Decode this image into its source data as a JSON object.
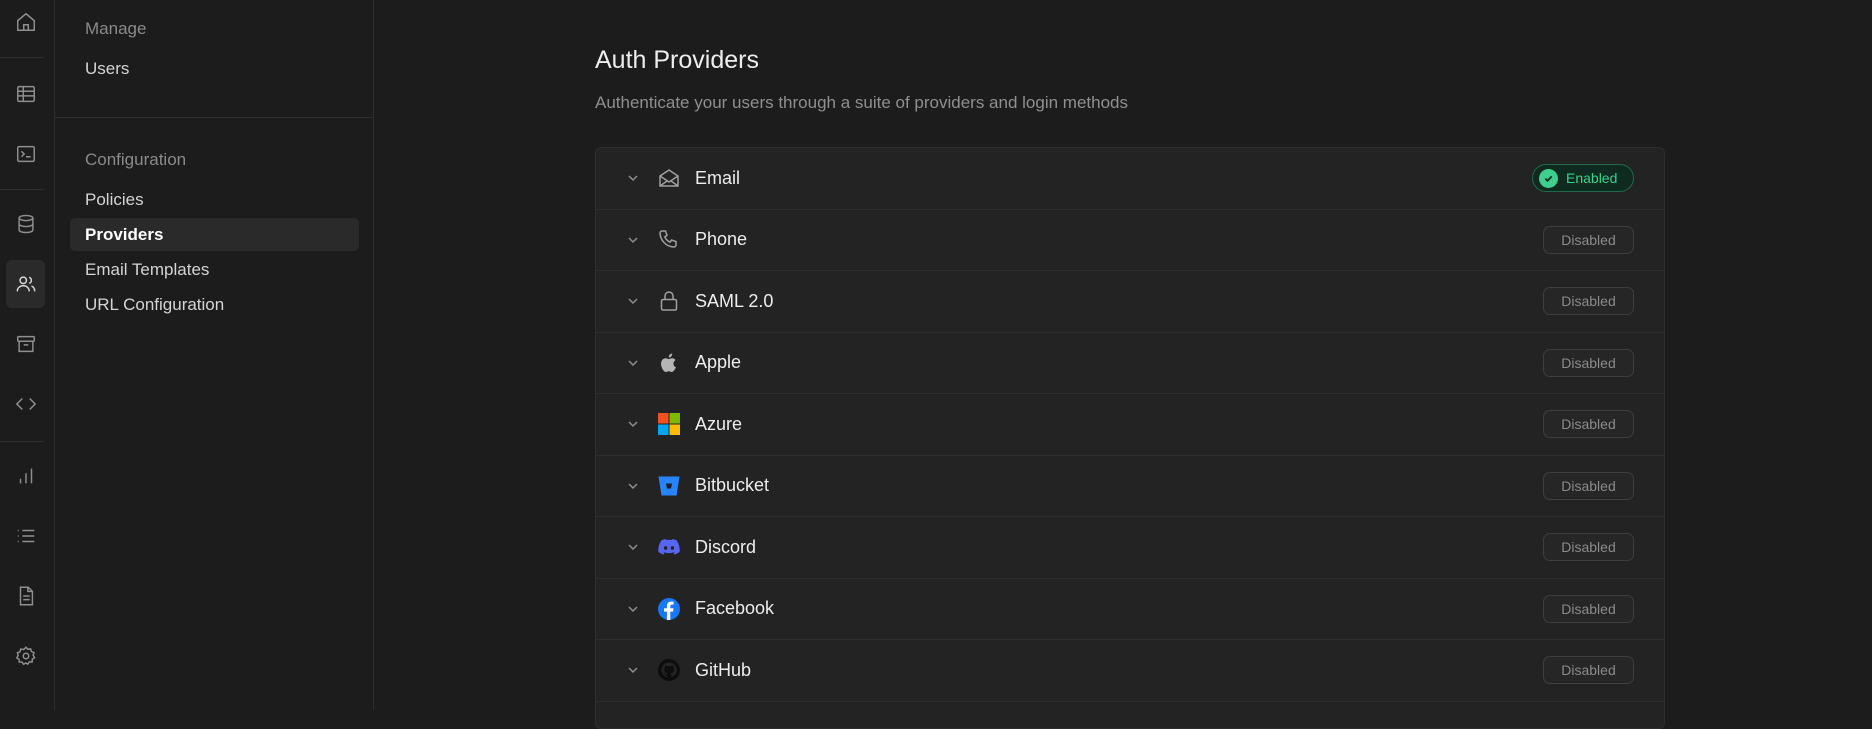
{
  "menu": {
    "manage_heading": "Manage",
    "users_label": "Users",
    "config_heading": "Configuration",
    "items": [
      {
        "label": "Policies"
      },
      {
        "label": "Providers"
      },
      {
        "label": "Email Templates"
      },
      {
        "label": "URL Configuration"
      }
    ]
  },
  "main": {
    "title": "Auth Providers",
    "subtitle": "Authenticate your users through a suite of providers and login methods",
    "providers": [
      {
        "name": "Email",
        "status": "Enabled",
        "icon": "envelope-icon"
      },
      {
        "name": "Phone",
        "status": "Disabled",
        "icon": "phone-icon"
      },
      {
        "name": "SAML 2.0",
        "status": "Disabled",
        "icon": "lock-icon"
      },
      {
        "name": "Apple",
        "status": "Disabled",
        "icon": "apple-icon"
      },
      {
        "name": "Azure",
        "status": "Disabled",
        "icon": "azure-icon"
      },
      {
        "name": "Bitbucket",
        "status": "Disabled",
        "icon": "bitbucket-icon"
      },
      {
        "name": "Discord",
        "status": "Disabled",
        "icon": "discord-icon"
      },
      {
        "name": "Facebook",
        "status": "Disabled",
        "icon": "facebook-icon"
      },
      {
        "name": "GitHub",
        "status": "Disabled",
        "icon": "github-icon"
      }
    ]
  },
  "colors": {
    "background": "#1c1c1c",
    "accent_green": "#3ecf8e",
    "bitbucket": "#2684ff",
    "discord": "#5865f2",
    "facebook": "#1877f2"
  },
  "rail_icons": [
    "home-icon",
    "table-icon",
    "terminal-icon",
    "database-icon",
    "users-icon",
    "archive-icon",
    "code-icon",
    "chart-icon",
    "list-icon",
    "document-icon",
    "gear-icon"
  ]
}
